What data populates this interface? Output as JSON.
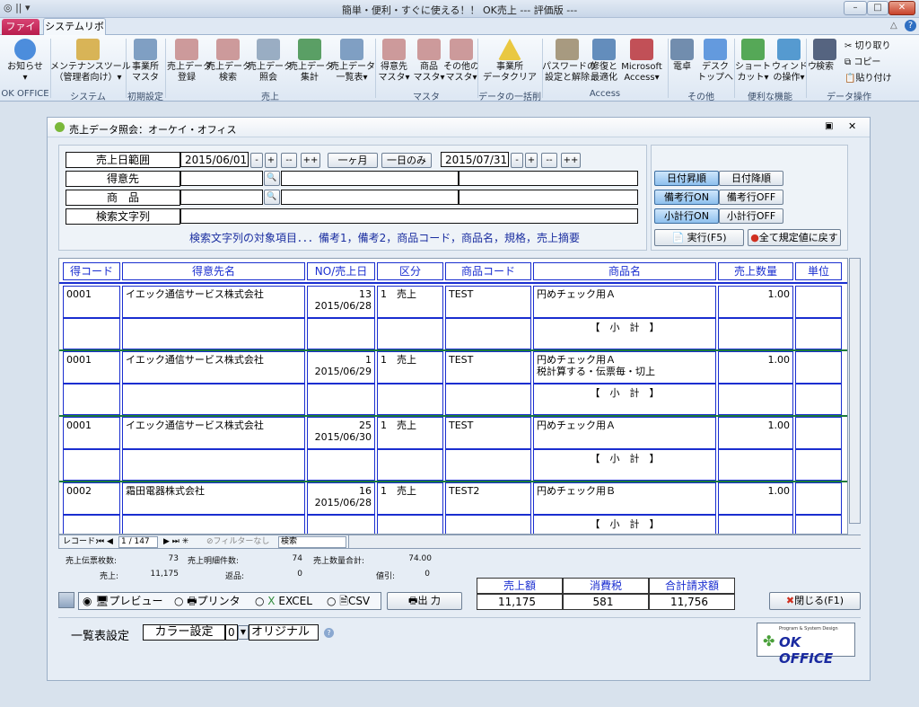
{
  "window": {
    "title": "簡単・便利・すぐに使える！！ OK売上 --- 評価版 ---",
    "qat": "◎ || ▾",
    "min": "–",
    "max": "□",
    "close": "✕"
  },
  "tabs": {
    "file": "ファイル",
    "system_ribbon": "システムリボン",
    "help": "?",
    "collapse": "△"
  },
  "ribbon": {
    "groups": [
      {
        "label": "OK OFFICE"
      },
      {
        "label": "システム"
      },
      {
        "label": "初期設定"
      },
      {
        "label": "売上"
      },
      {
        "label": "マスタ"
      },
      {
        "label": "データの一括削除"
      },
      {
        "label": "Access"
      },
      {
        "label": "その他"
      },
      {
        "label": "便利な機能"
      },
      {
        "label": "データ操作"
      }
    ],
    "buttons": [
      {
        "label": "お知らせ\n▾",
        "icon": "info-icon",
        "color": "#2f7ad6"
      },
      {
        "label": "メンテナンスツール\n（管理者向け）▾",
        "icon": "keys-icon",
        "color": "#d4a83a"
      },
      {
        "label": "事業所\nマスタ",
        "icon": "table-icon",
        "color": "#6b8fb8"
      },
      {
        "label": "売上データ\n登録",
        "icon": "table-icon",
        "color": "#c58a8a"
      },
      {
        "label": "売上データ\n検索",
        "icon": "table-icon",
        "color": "#c58a8a"
      },
      {
        "label": "売上データ\n照会",
        "icon": "magnifier-icon",
        "color": "#8aa0b8"
      },
      {
        "label": "売上データ\n集計",
        "icon": "excel-icon",
        "color": "#3f8f4a"
      },
      {
        "label": "売上データ\n一覧表▾",
        "icon": "list-icon",
        "color": "#6b8fb8"
      },
      {
        "label": "得意先\nマスタ▾",
        "icon": "table-icon",
        "color": "#c58a8a"
      },
      {
        "label": "商品\nマスタ▾",
        "icon": "table-icon",
        "color": "#c58a8a"
      },
      {
        "label": "その他の\nマスタ▾",
        "icon": "table-icon",
        "color": "#c58a8a"
      },
      {
        "label": "事業所\nデータクリア",
        "icon": "warning-icon",
        "color": "#e8c020"
      },
      {
        "label": "パスワードの\n設定と解除",
        "icon": "password-icon",
        "color": "#9a8a6a"
      },
      {
        "label": "修復と\n最適化",
        "icon": "repair-icon",
        "color": "#4a7ab0"
      },
      {
        "label": "Microsoft\nAccess▾",
        "icon": "access-icon",
        "color": "#b8323a"
      },
      {
        "label": "電卓",
        "icon": "calculator-icon",
        "color": "#5a7aa0"
      },
      {
        "label": "デスク\nトップへ",
        "icon": "desktop-icon",
        "color": "#4a8ad8"
      },
      {
        "label": "ショート\nカット▾",
        "icon": "shortcut-icon",
        "color": "#3a9a3a"
      },
      {
        "label": "ウィンドウ\nの操作▾",
        "icon": "pin-icon",
        "color": "#3a8ac8"
      },
      {
        "label": "検索",
        "icon": "binoculars-icon",
        "color": "#3a4a6a"
      }
    ],
    "cut": "切り取り",
    "copy": "コピー",
    "paste": "貼り付け"
  },
  "form": {
    "title": "売上データ照会：オーケイ・オフィス",
    "date_range_label": "売上日範囲",
    "date_from": "2015/06/01",
    "date_to": "2015/07/31",
    "step_minus": "-",
    "step_plus": "+",
    "step_mm": "--",
    "step_pp": "++",
    "one_month": "一ヶ月",
    "one_day": "一日のみ",
    "customer_label": "得意先",
    "product_label": "商　品",
    "search_label": "検索文字列",
    "search_note": "検索文字列の対象項目．．．備考1，備考2，商品コード，商品名，規格，売上摘要",
    "date_asc": "日付昇順",
    "date_desc": "日付降順",
    "memo_on": "備考行ON",
    "memo_off": "備考行OFF",
    "subtotal_on": "小計行ON",
    "subtotal_off": "小計行OFF",
    "run": "実行(F5)",
    "reset": "全て規定値に戻す"
  },
  "grid": {
    "headers": [
      "得コード",
      "得意先名",
      "NO/売上日",
      "区分",
      "商品コード",
      "商品名",
      "売上数量",
      "単位"
    ],
    "rows": [
      {
        "code": "0001",
        "customer": "イエック通信サービス株式会社",
        "no": "13",
        "date": "2015/06/28",
        "kind": "1　売上",
        "pcode": "TEST",
        "product": "円めチェック用Ａ",
        "qty": "1.00",
        "subtotal": "【　小　計　】"
      },
      {
        "code": "0001",
        "customer": "イエック通信サービス株式会社",
        "no": "1",
        "date": "2015/06/29",
        "kind": "1　売上",
        "pcode": "TEST",
        "product": "円めチェック用Ａ\n税計算する・伝票毎・切上",
        "qty": "1.00",
        "subtotal": "【　小　計　】"
      },
      {
        "code": "0001",
        "customer": "イエック通信サービス株式会社",
        "no": "25",
        "date": "2015/06/30",
        "kind": "1　売上",
        "pcode": "TEST",
        "product": "円めチェック用Ａ",
        "qty": "1.00",
        "subtotal": "【　小　計　】"
      },
      {
        "code": "0002",
        "customer": "霜田電器株式会社",
        "no": "16",
        "date": "2015/06/28",
        "kind": "1　売上",
        "pcode": "TEST2",
        "product": "円めチェック用Ｂ",
        "qty": "1.00",
        "subtotal": "【　小　計　】"
      }
    ],
    "nav": {
      "record_label": "レコード:",
      "record": "1 / 147",
      "filter": "フィルターなし",
      "search": "検索"
    }
  },
  "stats": {
    "slips_label": "売上伝票枚数:",
    "slips": "73",
    "lines_label": "売上明細件数:",
    "lines": "74",
    "qty_label": "売上数量合計:",
    "qty": "74.00",
    "sales_label": "売上:",
    "sales": "11,175",
    "returns_label": "返品:",
    "returns": "0",
    "discount_label": "値引:",
    "discount": "0"
  },
  "totals": {
    "sales_label": "売上額",
    "tax_label": "消費税",
    "total_label": "合計請求額",
    "sales": "11,175",
    "tax": "581",
    "total": "11,756"
  },
  "output": {
    "preview": "プレビュー",
    "printer": "プリンタ",
    "excel": "EXCEL",
    "csv": "CSV",
    "output_btn": "出 力",
    "close_btn": "閉じる(F1)"
  },
  "list": {
    "label": "一覧表設定",
    "color_label": "カラー設定",
    "color_value": "0",
    "color_name": "オリジナル"
  },
  "logo": {
    "small": "Program & System Design",
    "text": "OK OFFICE"
  }
}
